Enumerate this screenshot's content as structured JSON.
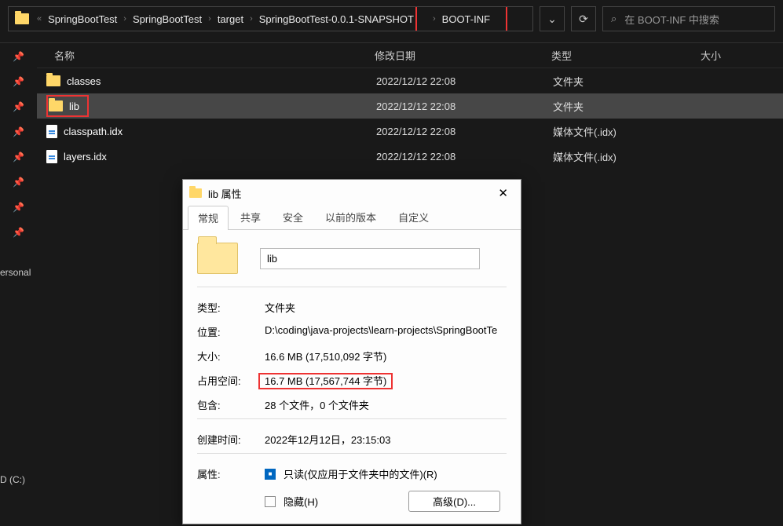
{
  "breadcrumb": {
    "prefix": "«",
    "segs": [
      "SpringBootTest",
      "SpringBootTest",
      "target",
      "SpringBootTest-0.0.1-SNAPSHOT",
      "BOOT-INF"
    ]
  },
  "search": {
    "icon": "🔍",
    "placeholder": "在 BOOT-INF 中搜索"
  },
  "toolbar": {
    "history": "⌄",
    "refresh": "⟳"
  },
  "columns": {
    "name": "名称",
    "date": "修改日期",
    "type": "类型",
    "size": "大小"
  },
  "rows": [
    {
      "icon": "folder",
      "name": "classes",
      "date": "2022/12/12 22:08",
      "type": "文件夹"
    },
    {
      "icon": "folder",
      "name": "lib",
      "date": "2022/12/12 22:08",
      "type": "文件夹",
      "selected": true,
      "highlight": true
    },
    {
      "icon": "file",
      "name": "classpath.idx",
      "date": "2022/12/12 22:08",
      "type": "媒体文件(.idx)"
    },
    {
      "icon": "file",
      "name": "layers.idx",
      "date": "2022/12/12 22:08",
      "type": "媒体文件(.idx)"
    }
  ],
  "sidebar": {
    "personal": "ersonal",
    "drive": "D (C:)"
  },
  "props": {
    "title": "lib 属性",
    "tabs": [
      "常规",
      "共享",
      "安全",
      "以前的版本",
      "自定义"
    ],
    "activeTab": 0,
    "name_value": "lib",
    "labels": {
      "type": "类型:",
      "location": "位置:",
      "size": "大小:",
      "disk": "占用空间:",
      "contains": "包含:",
      "created": "创建时间:",
      "attrs": "属性:",
      "readonly": "只读(仅应用于文件夹中的文件)(R)",
      "hidden": "隐藏(H)",
      "advanced": "高级(D)..."
    },
    "values": {
      "type": "文件夹",
      "location": "D:\\coding\\java-projects\\learn-projects\\SpringBootTe",
      "size": "16.6 MB (17,510,092 字节)",
      "disk": "16.7 MB (17,567,744 字节)",
      "contains": "28 个文件，0 个文件夹",
      "created": "2022年12月12日，23:15:03"
    }
  }
}
